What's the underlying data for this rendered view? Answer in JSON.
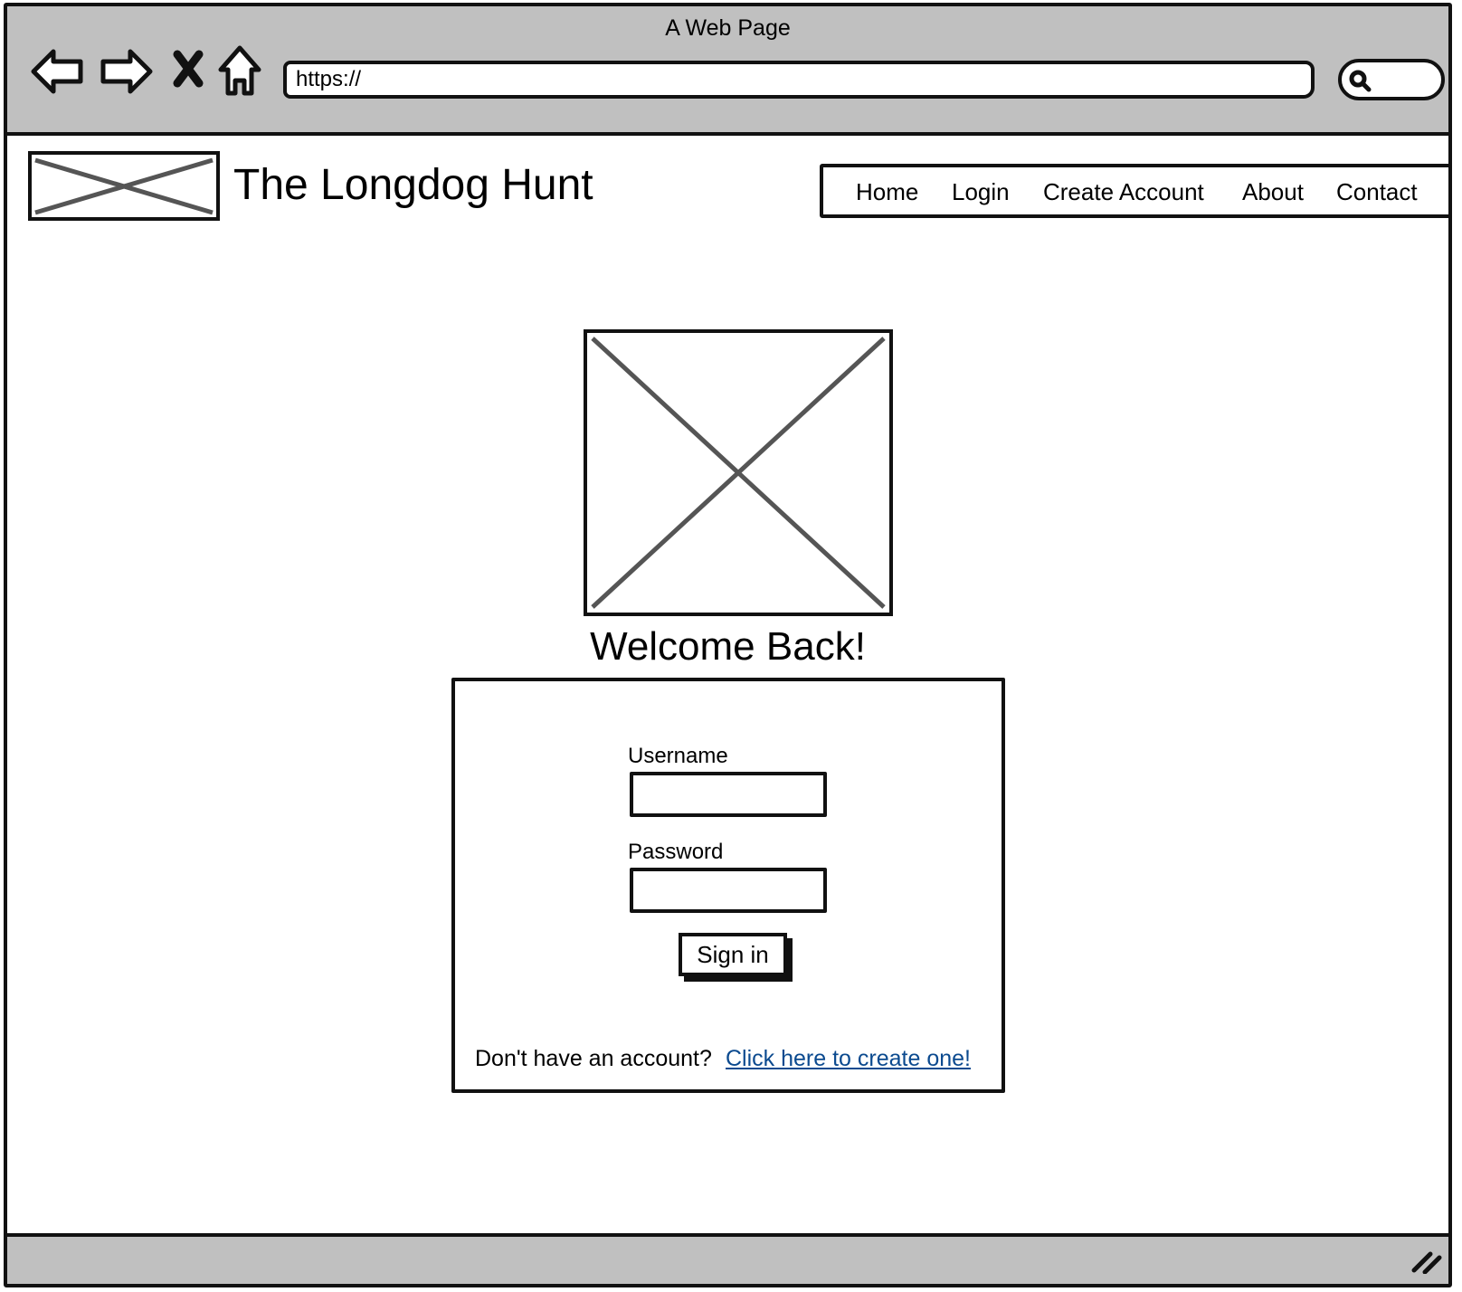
{
  "browser": {
    "window_title": "A Web Page",
    "url": "https://",
    "back_icon": "back-arrow-icon",
    "forward_icon": "forward-arrow-icon",
    "stop_icon": "close-x-icon",
    "home_icon": "home-icon",
    "search_icon": "search-icon"
  },
  "site": {
    "title": "The Longdog Hunt"
  },
  "nav": {
    "items": [
      {
        "label": "Home"
      },
      {
        "label": "Login"
      },
      {
        "label": "Create Account"
      },
      {
        "label": "About"
      },
      {
        "label": "Contact"
      }
    ]
  },
  "main": {
    "heading": "Welcome Back!",
    "form": {
      "username_label": "Username",
      "username_value": "",
      "password_label": "Password",
      "password_value": "",
      "submit_label": "Sign in",
      "signup_prompt": "Don't have an account?",
      "signup_link": "Click here to create one!"
    }
  },
  "colors": {
    "chrome": "#c0c0c0",
    "stroke": "#111111",
    "link": "#0b4a8f",
    "placeholder_cross": "#555555"
  }
}
